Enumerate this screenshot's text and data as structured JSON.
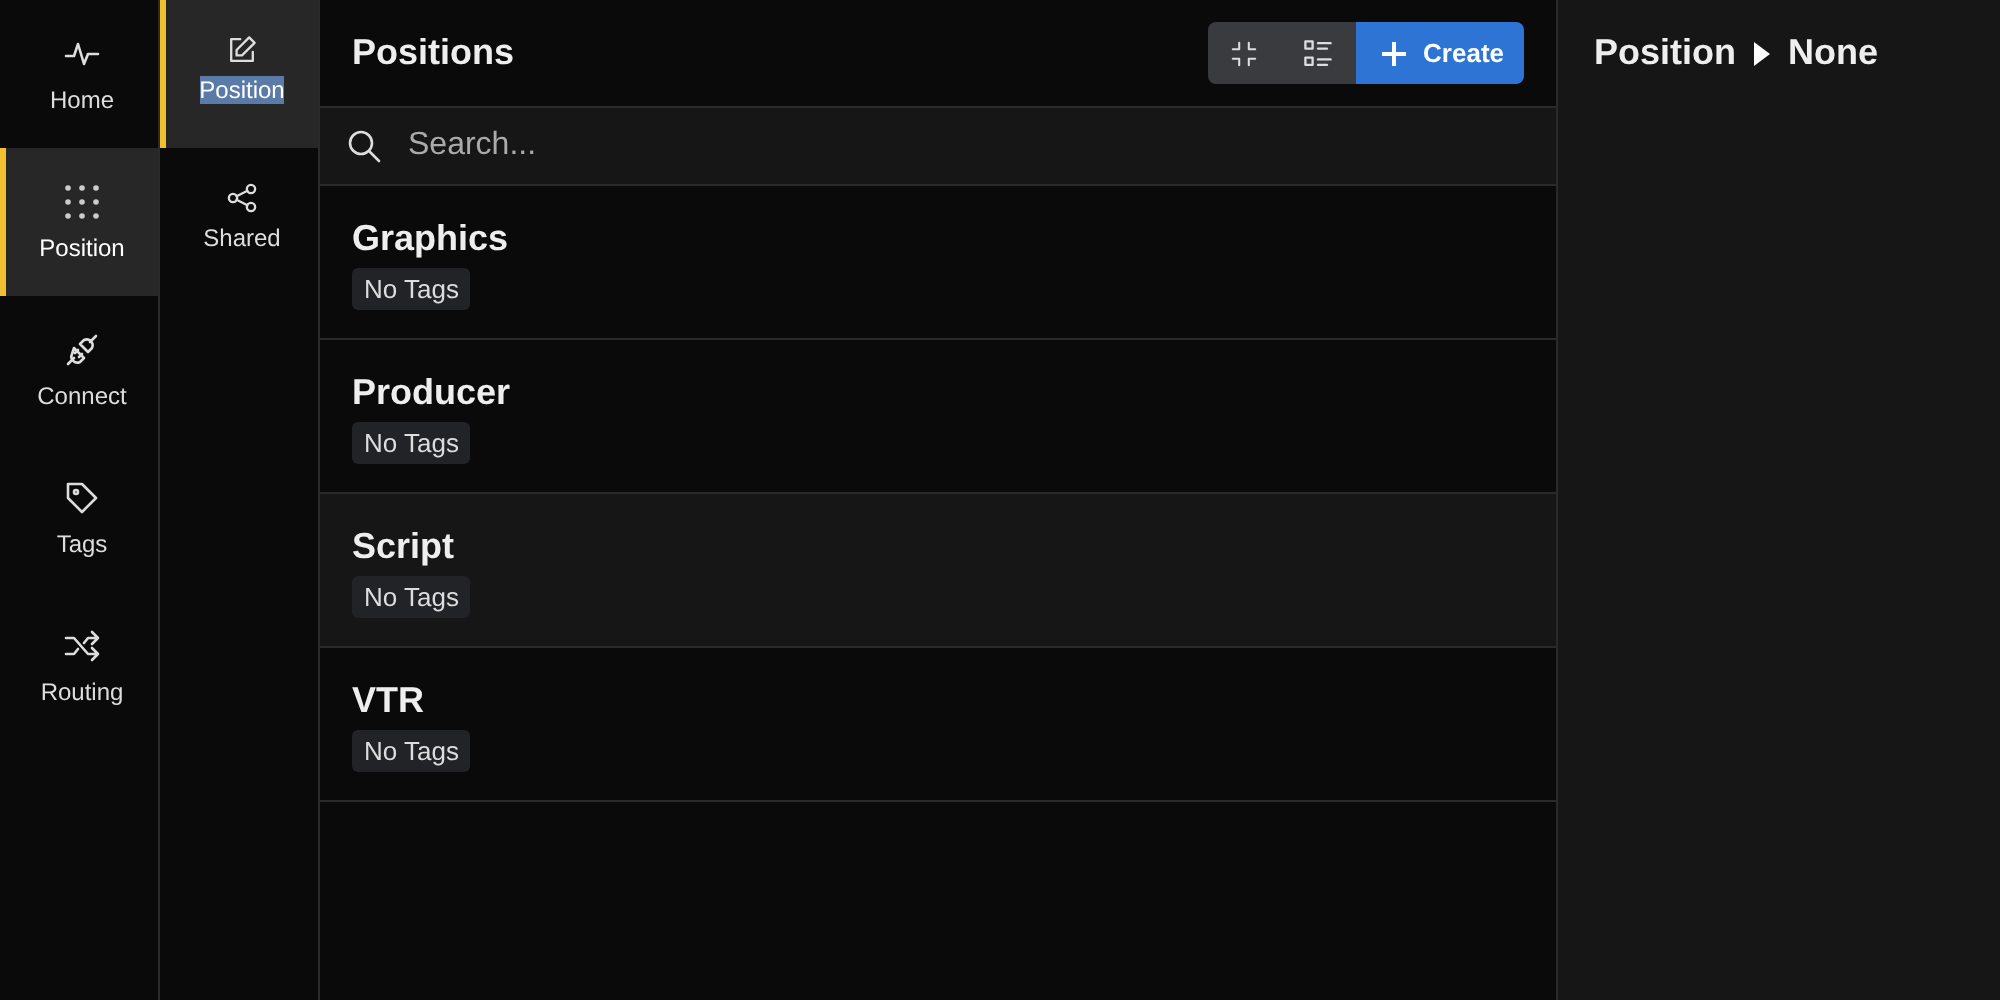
{
  "nav": [
    {
      "label": "Home",
      "selected": false
    },
    {
      "label": "Position",
      "selected": true
    },
    {
      "label": "Connect",
      "selected": false
    },
    {
      "label": "Tags",
      "selected": false
    },
    {
      "label": "Routing",
      "selected": false
    }
  ],
  "subnav": [
    {
      "label": "Position",
      "selected": true,
      "text_selected": true
    },
    {
      "label": "Shared",
      "selected": false,
      "text_selected": false
    }
  ],
  "list": {
    "title": "Positions",
    "create_label": "Create",
    "search_placeholder": "Search...",
    "rows": [
      {
        "name": "Graphics",
        "tag": "No Tags",
        "highlighted": false
      },
      {
        "name": "Producer",
        "tag": "No Tags",
        "highlighted": false
      },
      {
        "name": "Script",
        "tag": "No Tags",
        "highlighted": true
      },
      {
        "name": "VTR",
        "tag": "No Tags",
        "highlighted": false
      }
    ]
  },
  "detail": {
    "crumb": "Position",
    "value": "None"
  }
}
